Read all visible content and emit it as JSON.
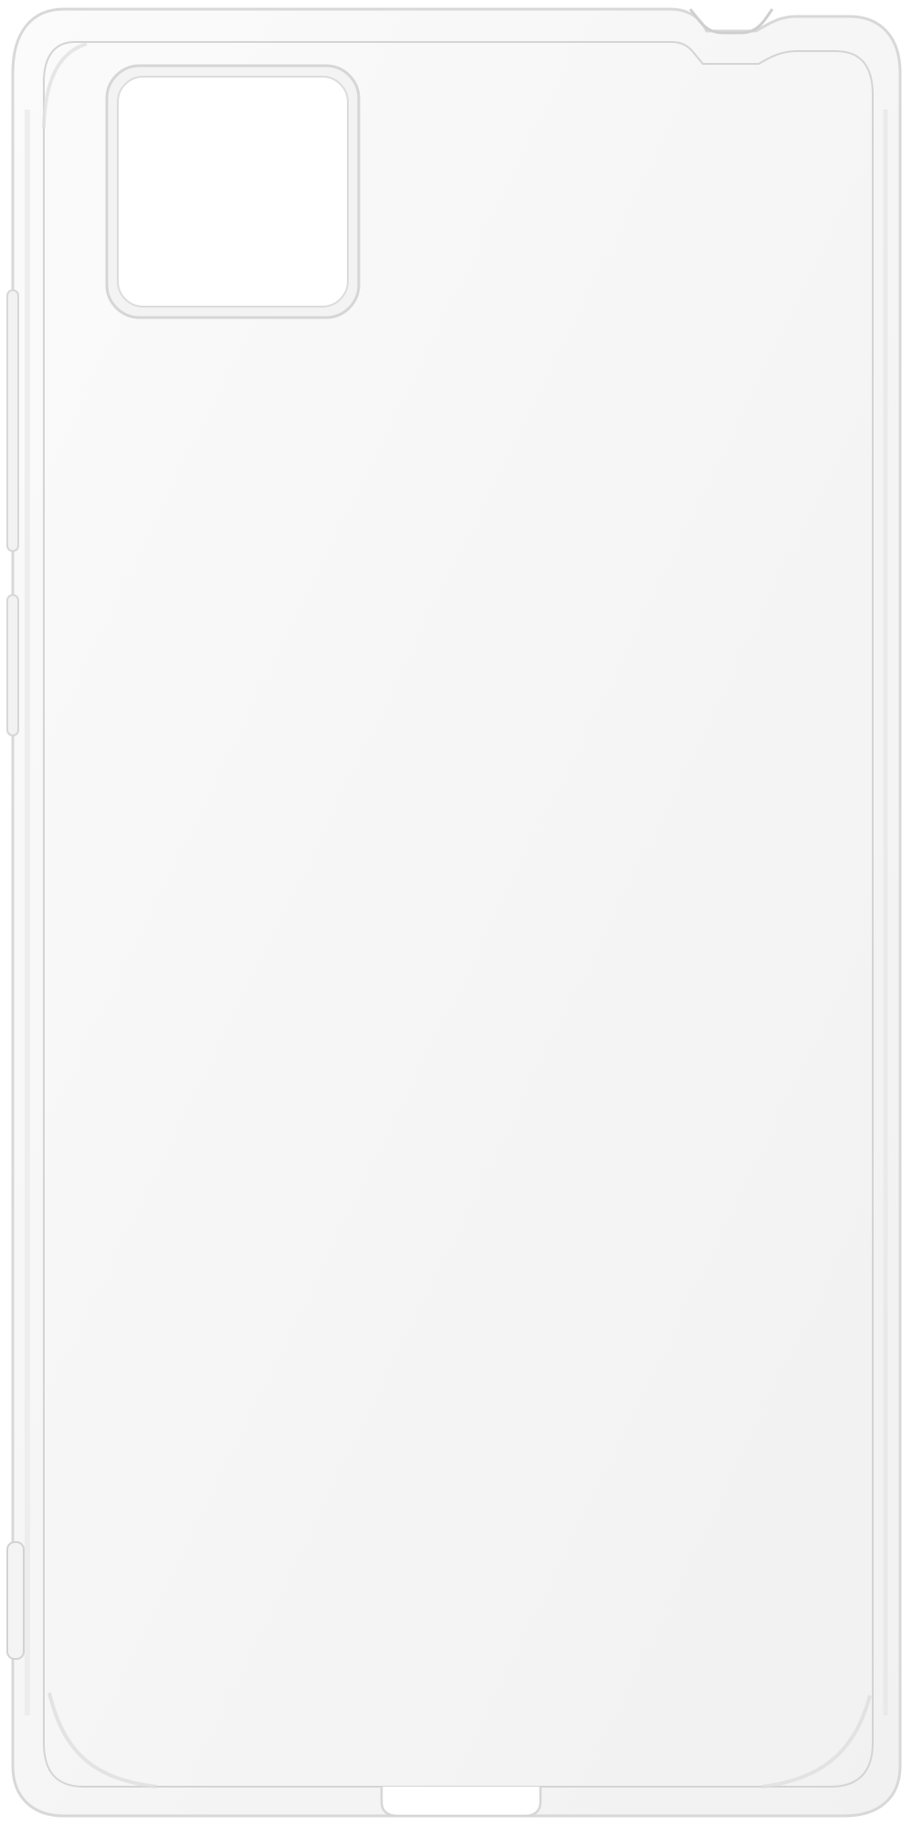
{
  "image": {
    "subject": "clear-phone-case",
    "colors": {
      "background": "#ffffff",
      "case_fill": "#f7f7f7",
      "case_edge": "#d9d9d9",
      "case_edge_dark": "#bfbfbf",
      "inner_line": "#d4d4d4",
      "camera_cutout_fill": "#ffffff"
    }
  }
}
